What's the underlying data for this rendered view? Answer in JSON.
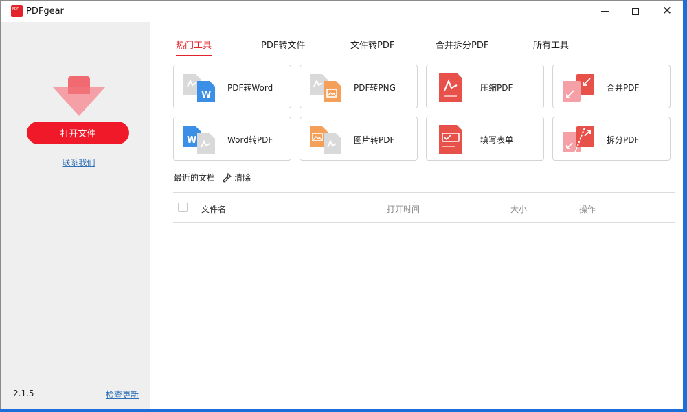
{
  "window": {
    "title": "PDFgear",
    "logo_text": "PDF Gear"
  },
  "sidebar": {
    "open_button": "打开文件",
    "contact_link": "联系我们",
    "version": "2.1.5",
    "update_link": "检查更新"
  },
  "tabs": [
    {
      "label": "热门工具",
      "active": true
    },
    {
      "label": "PDF转文件",
      "active": false
    },
    {
      "label": "文件转PDF",
      "active": false
    },
    {
      "label": "合并拆分PDF",
      "active": false
    },
    {
      "label": "所有工具",
      "active": false
    }
  ],
  "tools": [
    {
      "label": "PDF转Word",
      "icon": "pdf-to-word-icon"
    },
    {
      "label": "PDF转PNG",
      "icon": "pdf-to-png-icon"
    },
    {
      "label": "压缩PDF",
      "icon": "compress-pdf-icon"
    },
    {
      "label": "合并PDF",
      "icon": "merge-pdf-icon"
    },
    {
      "label": "Word转PDF",
      "icon": "word-to-pdf-icon"
    },
    {
      "label": "图片转PDF",
      "icon": "image-to-pdf-icon"
    },
    {
      "label": "填写表单",
      "icon": "fill-form-icon"
    },
    {
      "label": "拆分PDF",
      "icon": "split-pdf-icon"
    }
  ],
  "recent": {
    "title": "最近的文档",
    "clear_label": "清除",
    "columns": {
      "name": "文件名",
      "time": "打开时间",
      "size": "大小",
      "action": "操作"
    }
  },
  "colors": {
    "accent": "#e3232b",
    "button": "#f0192a",
    "link": "#2d6fb8",
    "sidebar_bg": "#efefef"
  }
}
